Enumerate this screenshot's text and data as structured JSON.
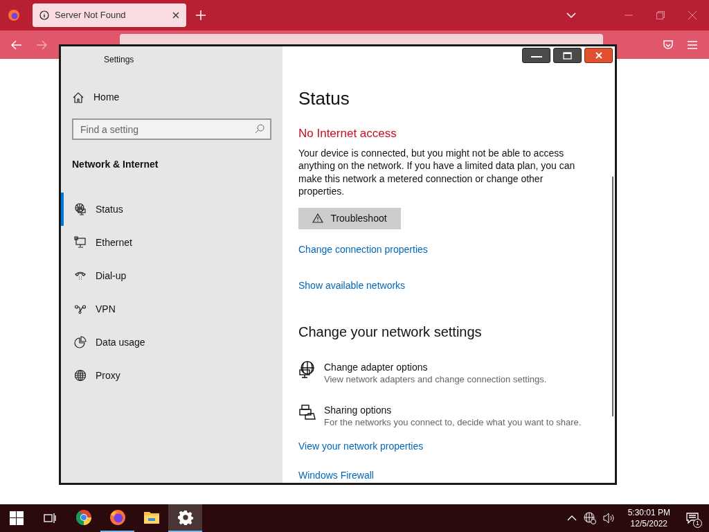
{
  "browser": {
    "tabs": [
      {
        "title": "Server Not Found",
        "selected": true
      }
    ]
  },
  "settings_window": {
    "title": "Settings",
    "sidebar": {
      "home": "Home",
      "search": {
        "placeholder": "Find a setting"
      },
      "section": "Network & Internet",
      "items": [
        {
          "label": "Status",
          "kind": "status",
          "selected": true
        },
        {
          "label": "Ethernet",
          "kind": "ethernet",
          "selected": false
        },
        {
          "label": "Dial-up",
          "kind": "dialup",
          "selected": false
        },
        {
          "label": "VPN",
          "kind": "vpn",
          "selected": false
        },
        {
          "label": "Data usage",
          "kind": "data",
          "selected": false
        },
        {
          "label": "Proxy",
          "kind": "proxy",
          "selected": false
        }
      ]
    },
    "content": {
      "heading": "Status",
      "alert": "No Internet access",
      "description": "Your device is connected, but you might not be able to access anything on the network. If you have a limited data plan, you can make this network a metered connection or change other properties.",
      "troubleshoot_button": "Troubleshoot",
      "links_top": [
        "Change connection properties",
        "Show available networks"
      ],
      "section_heading": "Change your network settings",
      "options": [
        {
          "title": "Change adapter options",
          "description": "View network adapters and change connection settings.",
          "kind": "adapter"
        },
        {
          "title": "Sharing options",
          "description": "For the networks you connect to, decide what you want to share.",
          "kind": "sharing"
        }
      ],
      "links_bottom": [
        "View your network properties",
        "Windows Firewall"
      ]
    }
  },
  "taskbar": {
    "apps": [
      {
        "kind": "chrome",
        "selected": false,
        "running": false
      },
      {
        "kind": "firefox",
        "selected": false,
        "running": true
      },
      {
        "kind": "folder",
        "selected": false,
        "running": false
      },
      {
        "kind": "settings",
        "selected": true,
        "running": true
      }
    ],
    "time": "5:30:01 PM",
    "date": "12/5/2022",
    "notification_count": "1"
  }
}
